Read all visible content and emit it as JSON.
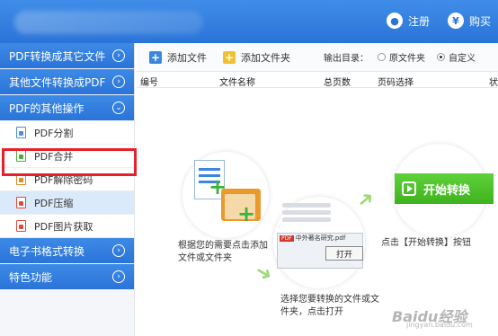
{
  "header": {
    "register": "注册",
    "buy": "购买"
  },
  "sidebar": {
    "categories": [
      {
        "label": "PDF转换成其它文件",
        "chevron": "›"
      },
      {
        "label": "其他文件转换成PDF",
        "chevron": "›"
      },
      {
        "label": "PDF的其他操作",
        "chevron": "⌄"
      }
    ],
    "sub_items": [
      {
        "label": "PDF分割"
      },
      {
        "label": "PDF合并"
      },
      {
        "label": "PDF解除密码"
      },
      {
        "label": "PDF压缩"
      },
      {
        "label": "PDF图片获取"
      }
    ],
    "bottom_categories": [
      {
        "label": "电子书格式转换",
        "chevron": "›"
      },
      {
        "label": "特色功能",
        "chevron": "›"
      }
    ]
  },
  "toolbar": {
    "add_file": "添加文件",
    "add_folder": "添加文件夹",
    "output_label": "输出目录：",
    "option_original": "原文件夹",
    "option_custom": "自定义"
  },
  "table": {
    "columns": [
      "编号",
      "文件名称",
      "总页数",
      "页码选择",
      "状"
    ]
  },
  "steps": {
    "step1": "根据您的需要点击添加文件或文件夹",
    "step2": "选择您要转换的文件或文件夹，点击打开",
    "step3": "点击【开始转换】按钮",
    "start_button": "开始转换",
    "open_button": "打开",
    "dialog_text": "中外著名研究.pdf"
  },
  "watermark": {
    "text": "Baidu经验",
    "sub": "jingyan.baidu.com"
  },
  "colors": {
    "accent": "#2a74d8",
    "highlight": "#e8202a",
    "green": "#3fb21f"
  }
}
